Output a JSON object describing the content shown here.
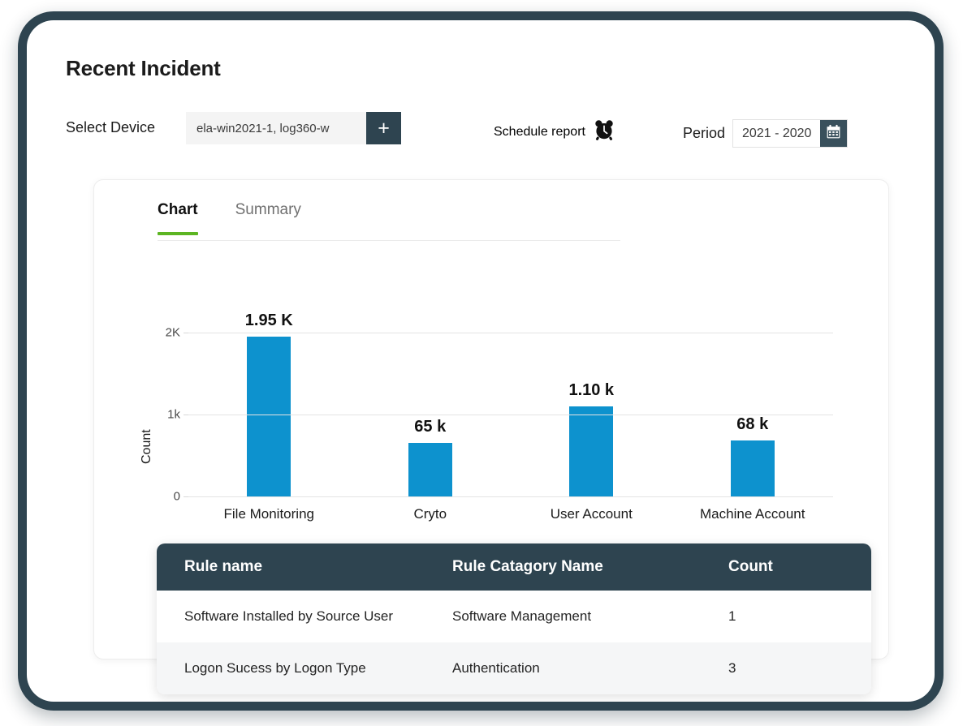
{
  "header": {
    "title": "Recent Incident"
  },
  "toolbar": {
    "device_label": "Select Device",
    "device_value": "ela-win2021-1, log360-w",
    "device_add_label": "+",
    "add_icon": "plus-icon",
    "schedule_label": "Schedule report",
    "schedule_icon": "alarm-clock-icon",
    "period_label": "Period",
    "period_value": "2021 - 2020",
    "period_icon": "calendar-icon"
  },
  "tabs": [
    {
      "label": "Chart",
      "active": true
    },
    {
      "label": "Summary",
      "active": false
    }
  ],
  "chart_data": {
    "type": "bar",
    "title": "",
    "xlabel": "",
    "ylabel": "Count",
    "categories": [
      "File Monitoring",
      "Cryto",
      "User Account",
      "Machine Account"
    ],
    "values": [
      1950,
      650,
      1100,
      680
    ],
    "value_labels": [
      "1.95 K",
      "65 k",
      "1.10 k",
      "68 k"
    ],
    "ytick_labels": [
      "0",
      "1k",
      "2K"
    ],
    "ytick_values": [
      0,
      1000,
      2000
    ],
    "ylim": [
      0,
      2200
    ],
    "grid": true,
    "legend": "none",
    "bar_color": "#0d92ce"
  },
  "table": {
    "columns": [
      "Rule name",
      "Rule Catagory Name",
      "Count"
    ],
    "rows": [
      {
        "rule": "Software Installed by Source User",
        "category": "Software Management",
        "count": "1"
      },
      {
        "rule": "Logon Sucess by Logon Type",
        "category": "Authentication",
        "count": "3"
      }
    ]
  },
  "colors": {
    "frame": "#2e4450",
    "accent_green": "#5cb522",
    "bar_blue": "#0d92ce",
    "table_header": "#2e4450"
  }
}
